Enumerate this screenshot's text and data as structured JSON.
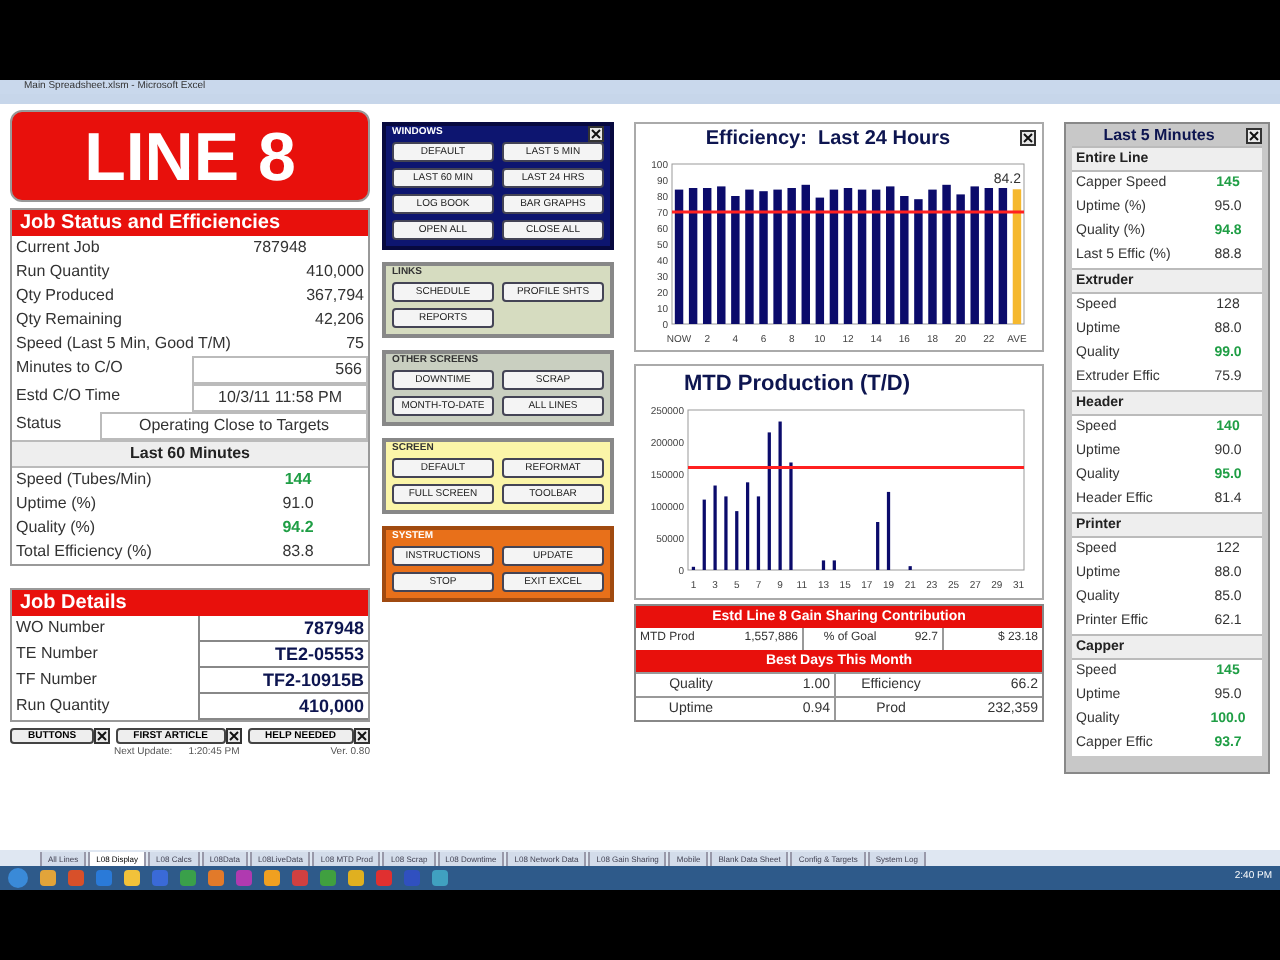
{
  "window": {
    "title": "Main Spreadsheet.xlsm - Microsoft Excel"
  },
  "banner": "LINE 8",
  "job_status": {
    "title": "Job Status and Efficiencies",
    "rows": [
      {
        "label": "Current Job",
        "value": "787948",
        "kind": "center"
      },
      {
        "label": "Run Quantity",
        "value": "410,000",
        "kind": "plain"
      },
      {
        "label": "Qty Produced",
        "value": "367,794",
        "kind": "plain"
      },
      {
        "label": "Qty Remaining",
        "value": "42,206",
        "kind": "plain"
      },
      {
        "label": "Speed (Last 5 Min, Good T/M)",
        "value": "75",
        "kind": "plain"
      },
      {
        "label": "Minutes to C/O",
        "value": "566",
        "kind": "field"
      },
      {
        "label": "Estd C/O Time",
        "value": "10/3/11 11:58 PM",
        "kind": "field_center"
      },
      {
        "label": "Status",
        "value": "Operating Close to Targets",
        "kind": "wide"
      }
    ]
  },
  "last_60": {
    "title": "Last 60 Minutes",
    "rows": [
      {
        "label": "Speed (Tubes/Min)",
        "value": "144",
        "good": true
      },
      {
        "label": "Uptime (%)",
        "value": "91.0",
        "good": false
      },
      {
        "label": "Quality (%)",
        "value": "94.2",
        "good": true
      },
      {
        "label": "Total Efficiency (%)",
        "value": "83.8",
        "good": false
      }
    ]
  },
  "job_details": {
    "title": "Job Details",
    "rows": [
      {
        "label": "WO Number",
        "value": "787948"
      },
      {
        "label": "TE Number",
        "value": "TE2-05553"
      },
      {
        "label": "TF Number",
        "value": "TF2-10915B"
      },
      {
        "label": "Run Quantity",
        "value": "410,000"
      }
    ]
  },
  "footer_buttons": [
    "BUTTONS",
    "FIRST ARTICLE",
    "HELP NEEDED"
  ],
  "next_update": {
    "label": "Next Update:",
    "value": "1:20:45 PM"
  },
  "version": "Ver. 0.80",
  "button_panels": [
    {
      "title": "WINDOWS",
      "kind": "windows",
      "closable": true,
      "buttons": [
        "DEFAULT",
        "LAST 5 MIN",
        "LAST 60 MIN",
        "LAST 24 HRS",
        "LOG BOOK",
        "BAR GRAPHS",
        "OPEN ALL",
        "CLOSE ALL"
      ]
    },
    {
      "title": "LINKS",
      "kind": "links",
      "closable": false,
      "buttons": [
        "SCHEDULE",
        "PROFILE SHTS",
        "REPORTS"
      ]
    },
    {
      "title": "OTHER SCREENS",
      "kind": "other",
      "closable": false,
      "buttons": [
        "DOWNTIME",
        "SCRAP",
        "MONTH-TO-DATE",
        "ALL LINES"
      ]
    },
    {
      "title": "SCREEN",
      "kind": "screen",
      "closable": false,
      "buttons": [
        "DEFAULT",
        "REFORMAT",
        "FULL SCREEN",
        "TOOLBAR"
      ]
    },
    {
      "title": "SYSTEM",
      "kind": "system",
      "closable": false,
      "buttons": [
        "INSTRUCTIONS",
        "UPDATE",
        "STOP",
        "EXIT EXCEL"
      ]
    }
  ],
  "efficiency_chart": {
    "closable": true,
    "chart_data": {
      "type": "bar",
      "title": "Efficiency:  Last 24 Hours",
      "x": [
        0,
        1,
        2,
        3,
        4,
        5,
        6,
        7,
        8,
        9,
        10,
        11,
        12,
        13,
        14,
        15,
        16,
        17,
        18,
        19,
        20,
        21,
        22,
        23,
        24
      ],
      "series": [
        {
          "color": "#0b0b6b",
          "values": [
            84,
            85,
            85,
            86,
            80,
            84,
            83,
            84,
            85,
            87,
            79,
            84,
            85,
            84,
            84,
            86,
            80,
            78,
            84,
            87,
            81,
            86,
            85,
            85,
            null
          ]
        },
        {
          "color": "#f5b82e",
          "values": [
            null,
            null,
            null,
            null,
            null,
            null,
            null,
            null,
            null,
            null,
            null,
            null,
            null,
            null,
            null,
            null,
            null,
            null,
            null,
            null,
            null,
            null,
            null,
            null,
            84.2
          ]
        }
      ],
      "ylim": [
        0,
        100
      ],
      "yticks": [
        0,
        10,
        20,
        30,
        40,
        50,
        60,
        70,
        80,
        90,
        100
      ],
      "xticks": [
        {
          "value": 0,
          "label": "NOW"
        },
        {
          "value": 2,
          "label": "2"
        },
        {
          "value": 4,
          "label": "4"
        },
        {
          "value": 6,
          "label": "6"
        },
        {
          "value": 8,
          "label": "8"
        },
        {
          "value": 10,
          "label": "10"
        },
        {
          "value": 12,
          "label": "12"
        },
        {
          "value": 14,
          "label": "14"
        },
        {
          "value": 16,
          "label": "16"
        },
        {
          "value": 18,
          "label": "18"
        },
        {
          "value": 20,
          "label": "20"
        },
        {
          "value": 22,
          "label": "22"
        },
        {
          "value": 24,
          "label": "AVE"
        }
      ],
      "xlim": [
        -0.5,
        24.5
      ],
      "ref_lines": [
        {
          "axis": "y",
          "value": 70,
          "color": "#ff2020"
        }
      ],
      "annotations": [
        {
          "x": 24,
          "y": 84.2,
          "text": "84.2"
        }
      ]
    }
  },
  "mtd_chart": {
    "chart_data": {
      "type": "bar",
      "title": "MTD Production (T/D)",
      "x": [
        1,
        2,
        3,
        4,
        5,
        6,
        7,
        8,
        9,
        10,
        11,
        12,
        13,
        14,
        15,
        16,
        17,
        18,
        19,
        20,
        21,
        22,
        23,
        24,
        25,
        26,
        27,
        28,
        29,
        30,
        31
      ],
      "series": [
        {
          "color": "#0b0b6b",
          "values": [
            5000,
            110000,
            132000,
            115000,
            92000,
            137000,
            115000,
            215000,
            232000,
            168000,
            0,
            0,
            15000,
            15000,
            0,
            0,
            0,
            75000,
            122000,
            0,
            6000,
            0,
            0,
            0,
            0,
            0,
            0,
            0,
            0,
            0,
            0
          ]
        }
      ],
      "ylim": [
        0,
        250000
      ],
      "yticks": [
        0,
        50000,
        100000,
        150000,
        200000,
        250000
      ],
      "xticks": [
        1,
        3,
        5,
        7,
        9,
        11,
        13,
        15,
        17,
        19,
        21,
        23,
        25,
        27,
        29,
        31
      ],
      "xlim": [
        0.5,
        31.5
      ],
      "ref_lines": [
        {
          "axis": "y",
          "value": 160000,
          "color": "#ff2020"
        }
      ]
    }
  },
  "gain_sharing": {
    "title": "Estd Line 8 Gain Sharing Contribution",
    "cells": [
      "MTD Prod",
      "1,557,886",
      "% of Goal",
      "92.7",
      "$ 23.18"
    ]
  },
  "best_days": {
    "title": "Best Days This Month",
    "rows": [
      {
        "label": "Quality",
        "value": "1.00",
        "label2": "Efficiency",
        "value2": "66.2"
      },
      {
        "label": "Uptime",
        "value": "0.94",
        "label2": "Prod",
        "value2": "232,359"
      }
    ]
  },
  "last_5": {
    "title": "Last 5 Minutes",
    "closable": true,
    "sections": [
      {
        "title": "Entire Line",
        "rows": [
          {
            "label": "Capper Speed",
            "value": "145",
            "good": true
          },
          {
            "label": "Uptime (%)",
            "value": "95.0",
            "good": false
          },
          {
            "label": "Quality (%)",
            "value": "94.8",
            "good": true
          },
          {
            "label": "Last 5 Effic (%)",
            "value": "88.8",
            "good": false
          }
        ]
      },
      {
        "title": "Extruder",
        "rows": [
          {
            "label": "Speed",
            "value": "128",
            "good": false
          },
          {
            "label": "Uptime",
            "value": "88.0",
            "good": false
          },
          {
            "label": "Quality",
            "value": "99.0",
            "good": true
          },
          {
            "label": "Extruder Effic",
            "value": "75.9",
            "good": false
          }
        ]
      },
      {
        "title": "Header",
        "rows": [
          {
            "label": "Speed",
            "value": "140",
            "good": true
          },
          {
            "label": "Uptime",
            "value": "90.0",
            "good": false
          },
          {
            "label": "Quality",
            "value": "95.0",
            "good": true
          },
          {
            "label": "Header Effic",
            "value": "81.4",
            "good": false
          }
        ]
      },
      {
        "title": "Printer",
        "rows": [
          {
            "label": "Speed",
            "value": "122",
            "good": false
          },
          {
            "label": "Uptime",
            "value": "88.0",
            "good": false
          },
          {
            "label": "Quality",
            "value": "85.0",
            "good": false
          },
          {
            "label": "Printer Effic",
            "value": "62.1",
            "good": false
          }
        ]
      },
      {
        "title": "Capper",
        "rows": [
          {
            "label": "Speed",
            "value": "145",
            "good": true
          },
          {
            "label": "Uptime",
            "value": "95.0",
            "good": false
          },
          {
            "label": "Quality",
            "value": "100.0",
            "good": true
          },
          {
            "label": "Capper Effic",
            "value": "93.7",
            "good": true
          }
        ]
      }
    ]
  },
  "sheet_tabs": [
    {
      "label": "All Lines",
      "selected": false
    },
    {
      "label": "L08 Display",
      "selected": true
    },
    {
      "label": "L08 Calcs",
      "selected": false
    },
    {
      "label": "L08Data",
      "selected": false
    },
    {
      "label": "L08LiveData",
      "selected": false
    },
    {
      "label": "L08 MTD Prod",
      "selected": false
    },
    {
      "label": "L08 Scrap",
      "selected": false
    },
    {
      "label": "L08 Downtime",
      "selected": false
    },
    {
      "label": "L08 Network Data",
      "selected": false
    },
    {
      "label": "L08 Gain Sharing",
      "selected": false
    },
    {
      "label": "Mobile",
      "selected": false
    },
    {
      "label": "Blank Data Sheet",
      "selected": false
    },
    {
      "label": "Config & Targets",
      "selected": false
    },
    {
      "label": "System Log",
      "selected": false
    }
  ],
  "taskbar": {
    "clock": "2:40 PM"
  }
}
